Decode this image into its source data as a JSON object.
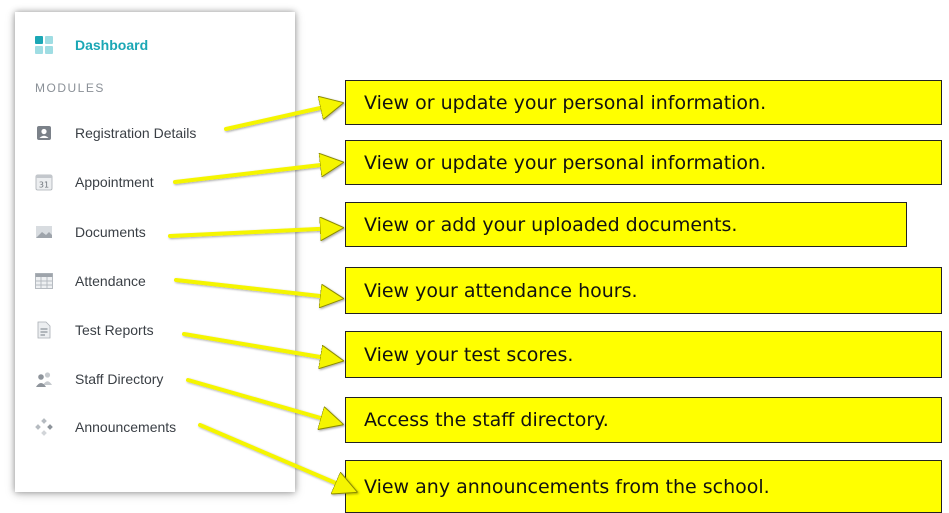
{
  "sidebar": {
    "dashboard_label": "Dashboard",
    "section_title": "MODULES",
    "items": [
      {
        "label": "Registration Details",
        "icon": "contact-card-icon"
      },
      {
        "label": "Appointment",
        "icon": "calendar-icon",
        "icon_text": "31"
      },
      {
        "label": "Documents",
        "icon": "image-icon"
      },
      {
        "label": "Attendance",
        "icon": "grid-table-icon"
      },
      {
        "label": "Test Reports",
        "icon": "document-icon"
      },
      {
        "label": "Staff Directory",
        "icon": "people-icon"
      },
      {
        "label": "Announcements",
        "icon": "diamond-dots-icon"
      }
    ]
  },
  "callouts": [
    "View or update your personal information.",
    "View or update your personal information.",
    "View or add your uploaded documents.",
    "View your attendance hours.",
    "View your test scores.",
    "Access the staff directory.",
    "View any announcements from the school."
  ],
  "colors": {
    "accent": "#1ba7b5",
    "callout_fill": "#ffff00",
    "arrow": "#f5f500"
  }
}
